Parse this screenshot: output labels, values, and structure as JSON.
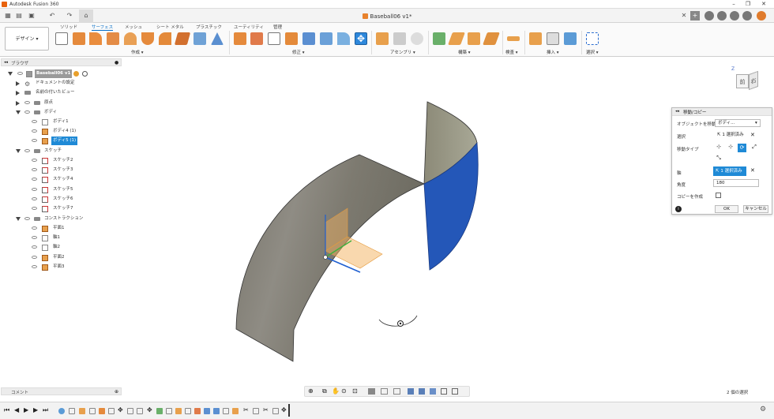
{
  "app": {
    "title": "Autodesk Fusion 360",
    "document_tab": "Baseball06 v1*"
  },
  "window_controls": {
    "minimize": "–",
    "maximize": "❐",
    "close": "✕"
  },
  "ribbon": {
    "workspace_button": "デザイン ▾",
    "tabs": [
      "ソリッド",
      "サーフェス",
      "メッシュ",
      "シート メタル",
      "プラスチック",
      "ユーティリティ",
      "管理"
    ],
    "active_tab": "サーフェス",
    "groups": [
      "作成 ▾",
      "修正 ▾",
      "アセンブリ ▾",
      "構築 ▾",
      "検査 ▾",
      "挿入 ▾",
      "選択 ▾"
    ]
  },
  "browser": {
    "title": "ブラウザ",
    "items": [
      {
        "label": "Baseball06 v1"
      },
      {
        "label": "ドキュメントの設定"
      },
      {
        "label": "名前の付いたビュー"
      },
      {
        "label": "原点"
      },
      {
        "label": "ボディ"
      },
      {
        "label": "ボディ1"
      },
      {
        "label": "ボディ4 (1)"
      },
      {
        "label": "ボディ5 (1)"
      },
      {
        "label": "スケッチ"
      },
      {
        "label": "スケッチ2"
      },
      {
        "label": "スケッチ3"
      },
      {
        "label": "スケッチ4"
      },
      {
        "label": "スケッチ5"
      },
      {
        "label": "スケッチ6"
      },
      {
        "label": "スケッチ7"
      },
      {
        "label": "コンストラクション"
      },
      {
        "label": "平面1"
      },
      {
        "label": "軸1"
      },
      {
        "label": "軸2"
      },
      {
        "label": "平面2"
      },
      {
        "label": "平面3"
      }
    ]
  },
  "dialog": {
    "title": "移動/コピー",
    "object_label": "オブジェクトを移動",
    "object_value": "ボディ...",
    "select_label": "選択",
    "select_value": "1 選択済み",
    "move_type_label": "移動タイプ",
    "axis_label": "軸",
    "axis_value": "1 選択済み",
    "angle_label": "角度",
    "angle_value": "180",
    "copy_label": "コピーを作成",
    "ok": "OK",
    "cancel": "キャンセル",
    "info_icon": "i"
  },
  "viewcube": {
    "front": "前",
    "right": "右",
    "z": "Z"
  },
  "comment_bar": {
    "label": "コメント"
  },
  "status": {
    "selection": "2 個の選択"
  },
  "colors": {
    "accent": "#1f8ad6",
    "surface_grey": "#8c8a80",
    "surface_blue": "#2457b8",
    "plane_orange": "#f3b25e"
  }
}
